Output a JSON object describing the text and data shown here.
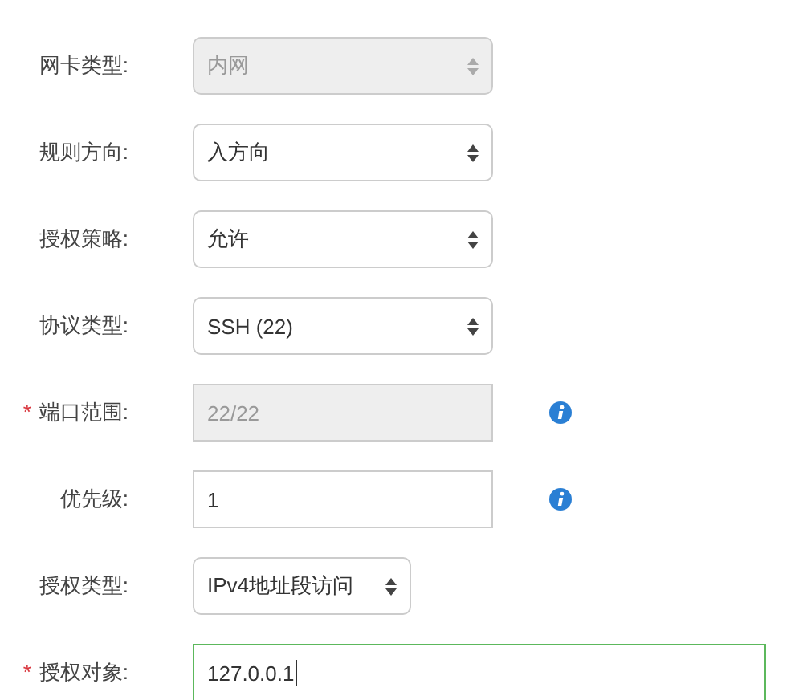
{
  "form": {
    "fields": [
      {
        "label": "网卡类型:",
        "kind": "select",
        "value": "内网",
        "disabled": true,
        "info": false,
        "focused": false
      },
      {
        "label": "规则方向:",
        "kind": "select",
        "value": "入方向",
        "disabled": false,
        "info": false,
        "focused": false
      },
      {
        "label": "授权策略:",
        "kind": "select",
        "value": "允许",
        "disabled": false,
        "info": false,
        "focused": false
      },
      {
        "label": "协议类型:",
        "kind": "select",
        "value": "SSH (22)",
        "disabled": false,
        "info": false,
        "focused": false
      },
      {
        "required_mark": "*",
        "label": "端口范围:",
        "kind": "input",
        "value": "22/22",
        "disabled": true,
        "info": true,
        "focused": false
      },
      {
        "label": "优先级:",
        "kind": "input",
        "value": "1",
        "disabled": false,
        "info": true,
        "focused": false
      },
      {
        "label": "授权类型:",
        "kind": "short-select",
        "value": "IPv4地址段访问",
        "disabled": false,
        "info": false,
        "focused": false
      },
      {
        "required_mark": "*",
        "label": "授权对象:",
        "kind": "wide-input",
        "value": "127.0.0.1",
        "disabled": false,
        "info": false,
        "focused": true
      }
    ]
  }
}
